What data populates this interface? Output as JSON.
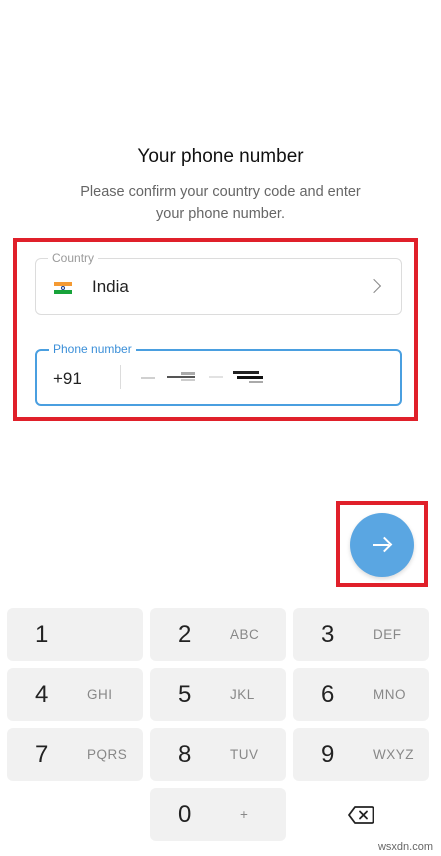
{
  "header": {
    "title": "Your phone number",
    "subtitle_line1": "Please confirm your country code and enter",
    "subtitle_line2": "your phone number."
  },
  "country": {
    "label": "Country",
    "value": "India",
    "flag_icon": "india-flag-icon"
  },
  "phone": {
    "label": "Phone number",
    "code": "+91",
    "value": ""
  },
  "next_button": {
    "icon": "arrow-right-icon",
    "color": "#5aa6e2"
  },
  "keypad": {
    "keys": [
      {
        "digit": "1",
        "letters": ""
      },
      {
        "digit": "2",
        "letters": "ABC"
      },
      {
        "digit": "3",
        "letters": "DEF"
      },
      {
        "digit": "4",
        "letters": "GHI"
      },
      {
        "digit": "5",
        "letters": "JKL"
      },
      {
        "digit": "6",
        "letters": "MNO"
      },
      {
        "digit": "7",
        "letters": "PQRS"
      },
      {
        "digit": "8",
        "letters": "TUV"
      },
      {
        "digit": "9",
        "letters": "WXYZ"
      },
      {
        "digit": "0",
        "letters": "+"
      }
    ]
  },
  "highlight_color": "#e0202a",
  "watermark": "wsxdn.com"
}
